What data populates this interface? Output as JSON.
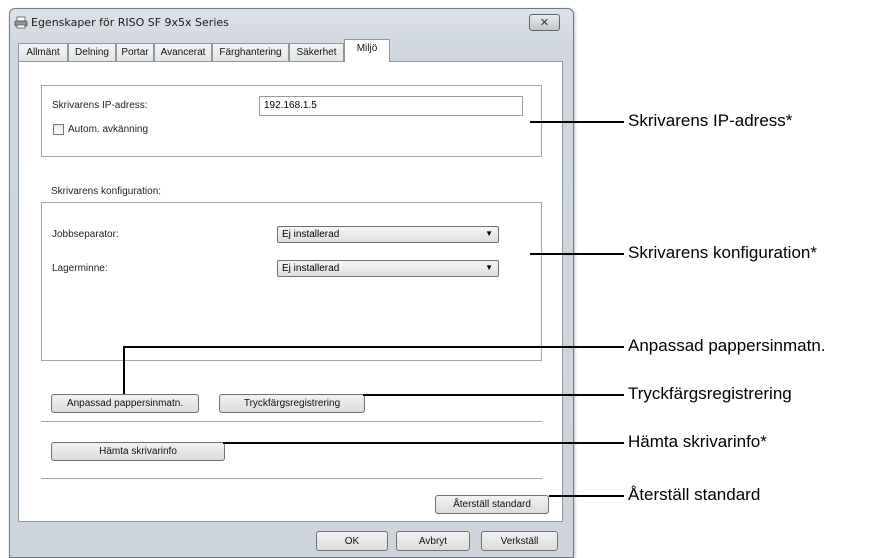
{
  "window": {
    "title": "Egenskaper för RISO SF 9x5x Series",
    "close_glyph": "✕"
  },
  "tabs": [
    {
      "label": "Allmänt"
    },
    {
      "label": "Delning"
    },
    {
      "label": "Portar"
    },
    {
      "label": "Avancerat"
    },
    {
      "label": "Färghantering"
    },
    {
      "label": "Säkerhet"
    },
    {
      "label": "Miljö",
      "active": true
    }
  ],
  "ip_section": {
    "label": "Skrivarens IP-adress:",
    "value": "192.168.1.5",
    "auto_detect_label": "Autom. avkänning",
    "auto_detect_checked": false
  },
  "config_section": {
    "heading": "Skrivarens konfiguration:",
    "job_separator_label": "Jobbseparator:",
    "job_separator_value": "Ej installerad",
    "storage_label": "Lagerminne:",
    "storage_value": "Ej installerad"
  },
  "buttons": {
    "custom_paper": "Anpassad pappersinmatn.",
    "ink_color": "Tryckfärgsregistrering",
    "get_info": "Hämta skrivarinfo",
    "restore_default": "Återställ standard"
  },
  "dialog_buttons": {
    "ok": "OK",
    "cancel": "Avbryt",
    "apply": "Verkställ"
  },
  "callouts": {
    "ip": "Skrivarens IP-adress*",
    "config": "Skrivarens konfiguration*",
    "custom_paper": "Anpassad pappersinmatn.",
    "ink_color": "Tryckfärgsregistrering",
    "get_info": "Hämta skrivarinfo*",
    "restore_default": "Återställ standard"
  },
  "icons": {
    "app": "printer-icon",
    "close": "close-icon",
    "dropdown": "chevron-down-icon"
  }
}
